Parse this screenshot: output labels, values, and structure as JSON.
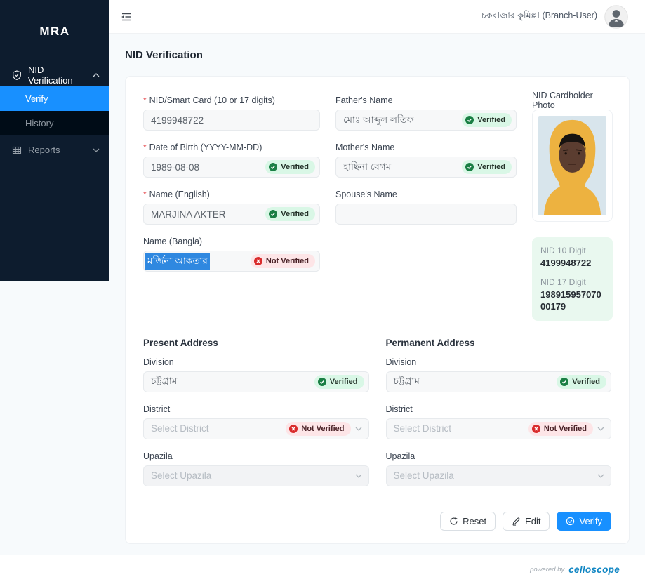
{
  "brand": {
    "name": "MRA"
  },
  "sidebar": {
    "nid_verification": {
      "label": "NID Verification"
    },
    "verify": {
      "label": "Verify"
    },
    "history": {
      "label": "History"
    },
    "reports": {
      "label": "Reports"
    }
  },
  "topbar": {
    "user_label": "চকবাজার কুমিল্লা (Branch-User)"
  },
  "page": {
    "title": "NID Verification"
  },
  "badges": {
    "verified": "Verified",
    "not_verified": "Not Verified"
  },
  "form": {
    "nid": {
      "label": "NID/Smart Card (10 or 17 digits)",
      "value": "4199948722",
      "required": true
    },
    "dob": {
      "label": "Date of Birth (YYYY-MM-DD)",
      "value": "1989-08-08",
      "status": "Verified",
      "required": true
    },
    "name_en": {
      "label": "Name (English)",
      "value": "MARJINA AKTER",
      "status": "Verified",
      "required": true
    },
    "name_bn": {
      "label": "Name (Bangla)",
      "value": "মর্জিনা আকতার",
      "status": "Not Verified",
      "text_selected": true
    },
    "father": {
      "label": "Father's Name",
      "value": "মোঃ আব্দুল লতিফ",
      "status": "Verified"
    },
    "mother": {
      "label": "Mother's Name",
      "value": "হাছিনা বেগম",
      "status": "Verified"
    },
    "spouse": {
      "label": "Spouse's Name",
      "value": ""
    },
    "photo_label": "NID Cardholder Photo",
    "nid_box": {
      "nid10_label": "NID 10 Digit",
      "nid10_value": "4199948722",
      "nid17_label": "NID 17 Digit",
      "nid17_value": "19891595707000179"
    }
  },
  "present_address": {
    "title": "Present Address",
    "division": {
      "label": "Division",
      "value": "চট্টগ্রাম",
      "status": "Verified"
    },
    "district": {
      "label": "District",
      "placeholder": "Select District",
      "status": "Not Verified"
    },
    "upazila": {
      "label": "Upazila",
      "placeholder": "Select Upazila"
    }
  },
  "permanent_address": {
    "title": "Permanent Address",
    "division": {
      "label": "Division",
      "value": "চট্টগ্রাম",
      "status": "Verified"
    },
    "district": {
      "label": "District",
      "placeholder": "Select District",
      "status": "Not Verified"
    },
    "upazila": {
      "label": "Upazila",
      "placeholder": "Select Upazila"
    }
  },
  "actions": {
    "reset": "Reset",
    "edit": "Edit",
    "verify": "Verify"
  },
  "footer": {
    "powered_by": "powered by",
    "brand": "celloscope"
  },
  "colors": {
    "primary": "#1890ff",
    "sidebar_bg": "#0d1c2e",
    "submenu_bg": "#000c17",
    "verified_green": "#1a7f44",
    "verified_bg": "#d9f7e6",
    "not_verified_red": "#d92c2c",
    "not_verified_bg": "#fde5e7",
    "nid_box_bg": "#e9f8ef",
    "celloscope_blue": "#1186c3",
    "selection_blue": "#2f88e0"
  }
}
